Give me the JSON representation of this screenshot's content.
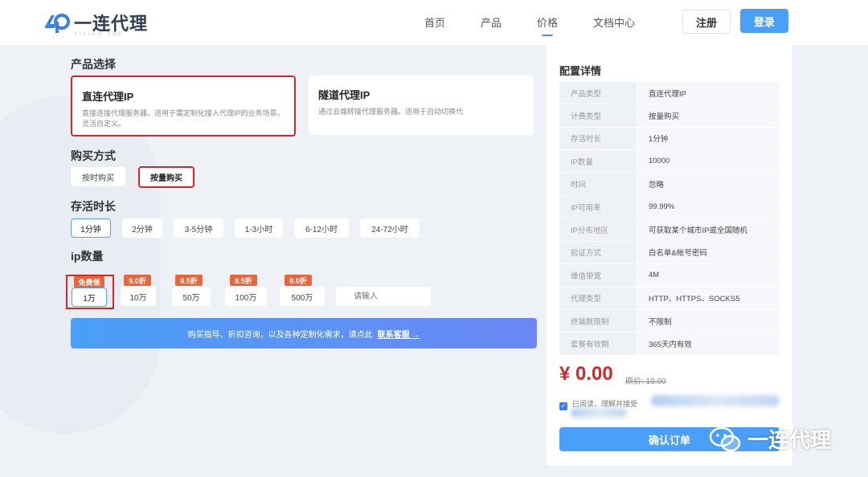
{
  "header": {
    "logo_text": "一连代理",
    "logo_sub": "YILIAN.TOP",
    "nav": [
      "首页",
      "产品",
      "价格",
      "文档中心"
    ],
    "register": "注册",
    "login": "登录"
  },
  "product": {
    "title": "产品选择",
    "cards": [
      {
        "title": "直连代理IP",
        "desc": "直接连接代理服务器。适用于需定制化接入代理IP的业务场景。灵活自定义。"
      },
      {
        "title": "隧道代理IP",
        "desc": "通过云端转接代理服务器。适用于自动切换代"
      }
    ]
  },
  "purchase": {
    "title": "购买方式",
    "options": [
      "按时购买",
      "按量购买"
    ]
  },
  "duration": {
    "title": "存活时长",
    "options": [
      "1分钟",
      "2分钟",
      "3-5分钟",
      "1-3小时",
      "6-12小时",
      "24-72小时"
    ]
  },
  "ipcount": {
    "title": "ip数量",
    "options": [
      {
        "badge": "免费领",
        "label": "1万"
      },
      {
        "badge": "9.0折",
        "label": "10万"
      },
      {
        "badge": "8.5折",
        "label": "50万"
      },
      {
        "badge": "8.5折",
        "label": "100万"
      },
      {
        "badge": "8.0折",
        "label": "500万"
      }
    ],
    "input_placeholder": "请输入"
  },
  "banner": {
    "text": "购买指导、折扣咨询，以及各种定制化需求，请点此",
    "link": "联系客服 →"
  },
  "panel": {
    "title": "配置详情",
    "rows": [
      {
        "k": "产品类型",
        "v": "直连代理IP"
      },
      {
        "k": "计费类型",
        "v": "按量购买"
      },
      {
        "k": "存活时长",
        "v": "1分钟"
      },
      {
        "k": "IP数量",
        "v": "10000"
      },
      {
        "k": "时间",
        "v": "忽略"
      },
      {
        "k": "IP可用率",
        "v": "99.99%"
      },
      {
        "k": "IP分布地区",
        "v": "可获取某个城市IP或全国随机"
      },
      {
        "k": "验证方式",
        "v": "白名单&帐号密码"
      },
      {
        "k": "峰值带宽",
        "v": "4M"
      },
      {
        "k": "代理类型",
        "v": "HTTP、HTTPS、SOCKS5"
      },
      {
        "k": "终端数限制",
        "v": "不限制"
      },
      {
        "k": "套餐有效期",
        "v": "365天内有效"
      }
    ],
    "price": "¥ 0.00",
    "orig_price": "原价: 19.00",
    "agree": "已阅读、理解并接受",
    "confirm": "确认订单"
  },
  "watermark": "一连代理",
  "colors": {
    "accent": "#4a9ff8",
    "highlight": "#d6262a",
    "badge": "#e8663c"
  }
}
